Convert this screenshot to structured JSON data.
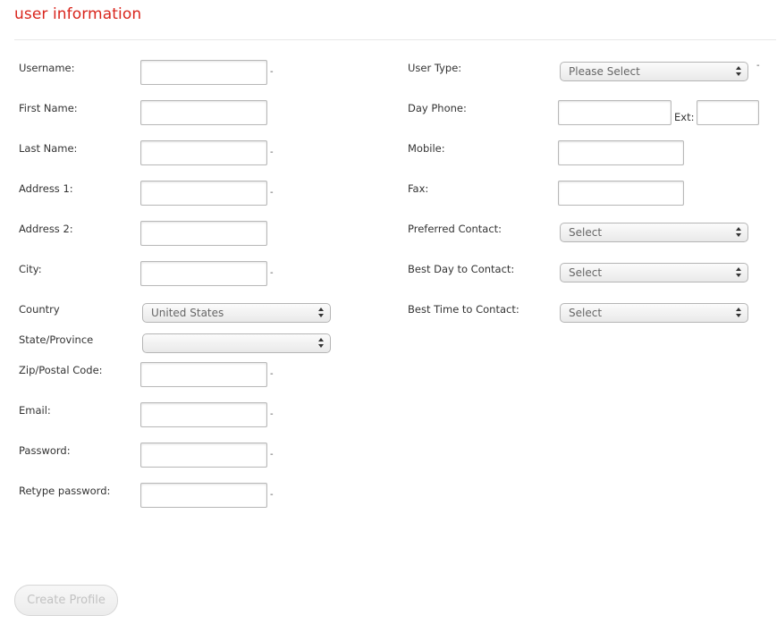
{
  "header": {
    "title": "user information"
  },
  "required_mark": "-",
  "left": {
    "username": "Username:",
    "first_name": "First Name:",
    "last_name": "Last Name:",
    "address1": "Address 1:",
    "address2": "Address 2:",
    "city": "City:",
    "country": "Country",
    "country_value": "United States",
    "state": "State/Province",
    "state_value": "",
    "zip": "Zip/Postal Code:",
    "email": "Email:",
    "password": "Password:",
    "retype_password": "Retype password:"
  },
  "right": {
    "user_type": "User Type:",
    "user_type_value": "Please Select",
    "day_phone": "Day Phone:",
    "ext": "Ext:",
    "mobile": "Mobile:",
    "fax": "Fax:",
    "preferred_contact": "Preferred Contact:",
    "preferred_contact_value": "Select",
    "best_day": "Best Day to Contact:",
    "best_day_value": "Select",
    "best_time": "Best Time to Contact:",
    "best_time_value": "Select"
  },
  "actions": {
    "create_profile": "Create Profile"
  }
}
